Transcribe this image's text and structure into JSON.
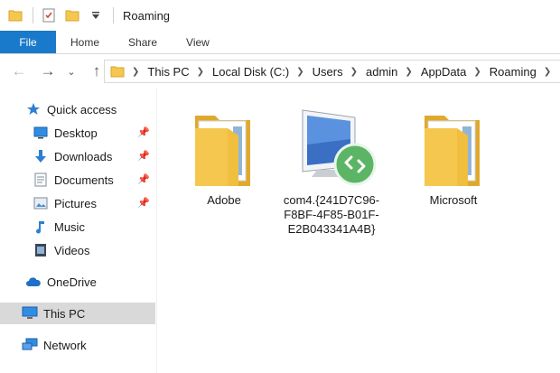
{
  "window": {
    "title": "Roaming"
  },
  "ribbon": {
    "file": "File",
    "tabs": [
      "Home",
      "Share",
      "View"
    ]
  },
  "address": {
    "crumbs": [
      "This PC",
      "Local Disk (C:)",
      "Users",
      "admin",
      "AppData",
      "Roaming"
    ]
  },
  "nav": {
    "quick_access": "Quick access",
    "items": [
      "Desktop",
      "Downloads",
      "Documents",
      "Pictures",
      "Music",
      "Videos"
    ],
    "onedrive": "OneDrive",
    "thispc": "This PC",
    "network": "Network"
  },
  "content": {
    "items": [
      {
        "label": "Adobe",
        "icon": "folder-icon"
      },
      {
        "label": "com4.{241D7C96-F8BF-4F85-B01F-E2B043341A4B}",
        "icon": "remote-desktop-icon"
      },
      {
        "label": "Microsoft",
        "icon": "folder-icon"
      }
    ]
  },
  "colors": {
    "file_tab": "#1979ca",
    "selected_nav": "#d9d9d9",
    "folder": "#f5c74e"
  }
}
